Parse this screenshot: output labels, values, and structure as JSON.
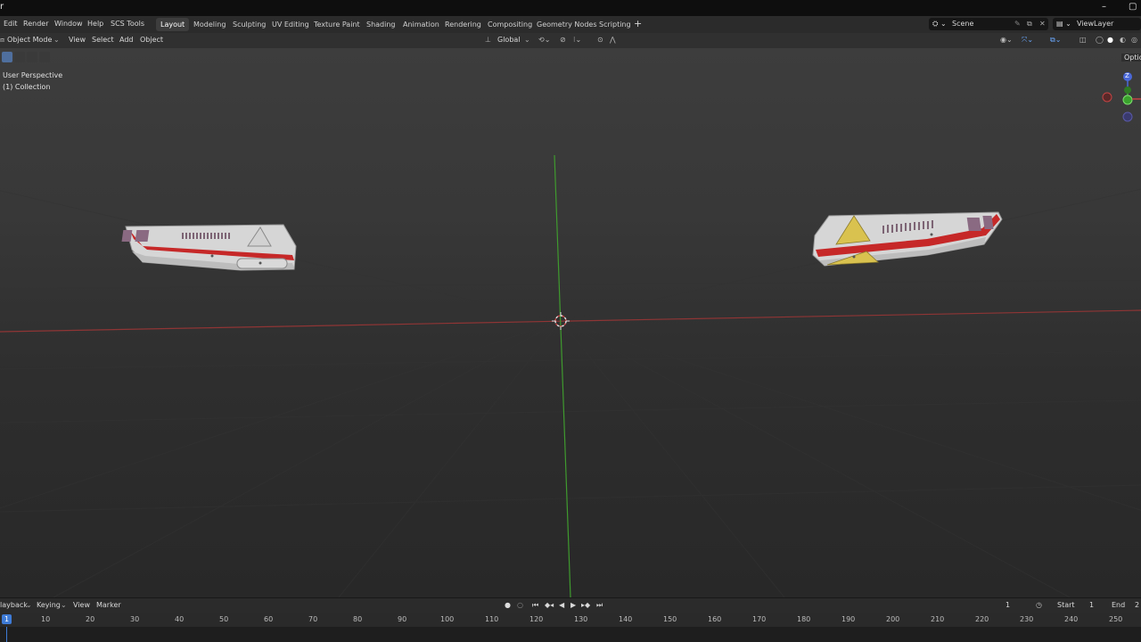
{
  "menus": [
    "Edit",
    "Render",
    "Window",
    "Help",
    "SCS Tools"
  ],
  "workspaces": [
    {
      "label": "Layout",
      "active": true
    },
    {
      "label": "Modeling",
      "active": false
    },
    {
      "label": "Sculpting",
      "active": false
    },
    {
      "label": "UV Editing",
      "active": false
    },
    {
      "label": "Texture Paint",
      "active": false
    },
    {
      "label": "Shading",
      "active": false
    },
    {
      "label": "Animation",
      "active": false
    },
    {
      "label": "Rendering",
      "active": false
    },
    {
      "label": "Compositing",
      "active": false
    },
    {
      "label": "Geometry Nodes",
      "active": false
    },
    {
      "label": "Scripting",
      "active": false
    }
  ],
  "add_workspace": "+",
  "scene": {
    "label": "Scene"
  },
  "view_layer": {
    "label": "ViewLayer"
  },
  "header": {
    "mode": "Object Mode",
    "menus": [
      "View",
      "Select",
      "Add",
      "Object"
    ],
    "orientation": "Global"
  },
  "viewport": {
    "perspective": "User Perspective",
    "collection": "(1) Collection",
    "options": "Option",
    "gizmo_axis": "Z"
  },
  "timeline": {
    "playback": "layback",
    "keying": "Keying",
    "view": "View",
    "marker": "Marker",
    "current_frame": "1",
    "start_label": "Start",
    "start": "1",
    "end_label": "End",
    "end": "2",
    "ruler": [
      "10",
      "20",
      "30",
      "40",
      "50",
      "60",
      "70",
      "80",
      "90",
      "100",
      "110",
      "120",
      "130",
      "140",
      "150",
      "160",
      "170",
      "180",
      "190",
      "200",
      "210",
      "220",
      "230",
      "240",
      "250"
    ],
    "indicator": "1"
  },
  "colors": {
    "accent": "#3e7bd6",
    "x_axis": "#a23a3a",
    "y_axis": "#3f9a2e",
    "lamp_red": "#c62828",
    "reflector_yellow": "#d9c24f"
  }
}
